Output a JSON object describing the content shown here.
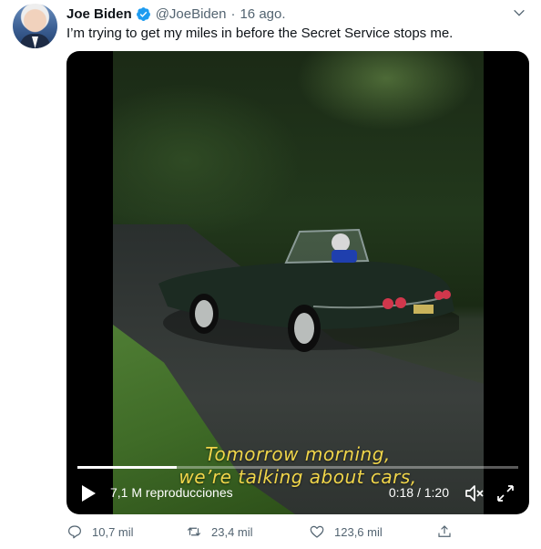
{
  "tweet": {
    "author_name": "Joe Biden",
    "handle": "@JoeBiden",
    "separator": "·",
    "date": "16 ago.",
    "text": "I’m trying to get my miles in before the Secret Service stops me."
  },
  "video": {
    "subtitle_line1": "Tomorrow morning,",
    "subtitle_line2": "we’re talking about cars,",
    "views": "7,1 M reproducciones",
    "time": "0:18 / 1:20",
    "progress": 0.225
  },
  "actions": {
    "replies": "10,7 mil",
    "retweets": "23,4 mil",
    "likes": "123,6 mil"
  },
  "icons": {
    "verified": "verified-badge-icon",
    "more": "chevron-down-icon",
    "play": "play-icon",
    "mute": "mute-icon",
    "fullscreen": "fullscreen-icon",
    "reply": "reply-icon",
    "retweet": "retweet-icon",
    "like": "heart-icon",
    "share": "share-icon"
  },
  "colors": {
    "verified": "#1d9bf0",
    "subtitle": "#f0d54a",
    "secondary_text": "#536471"
  }
}
